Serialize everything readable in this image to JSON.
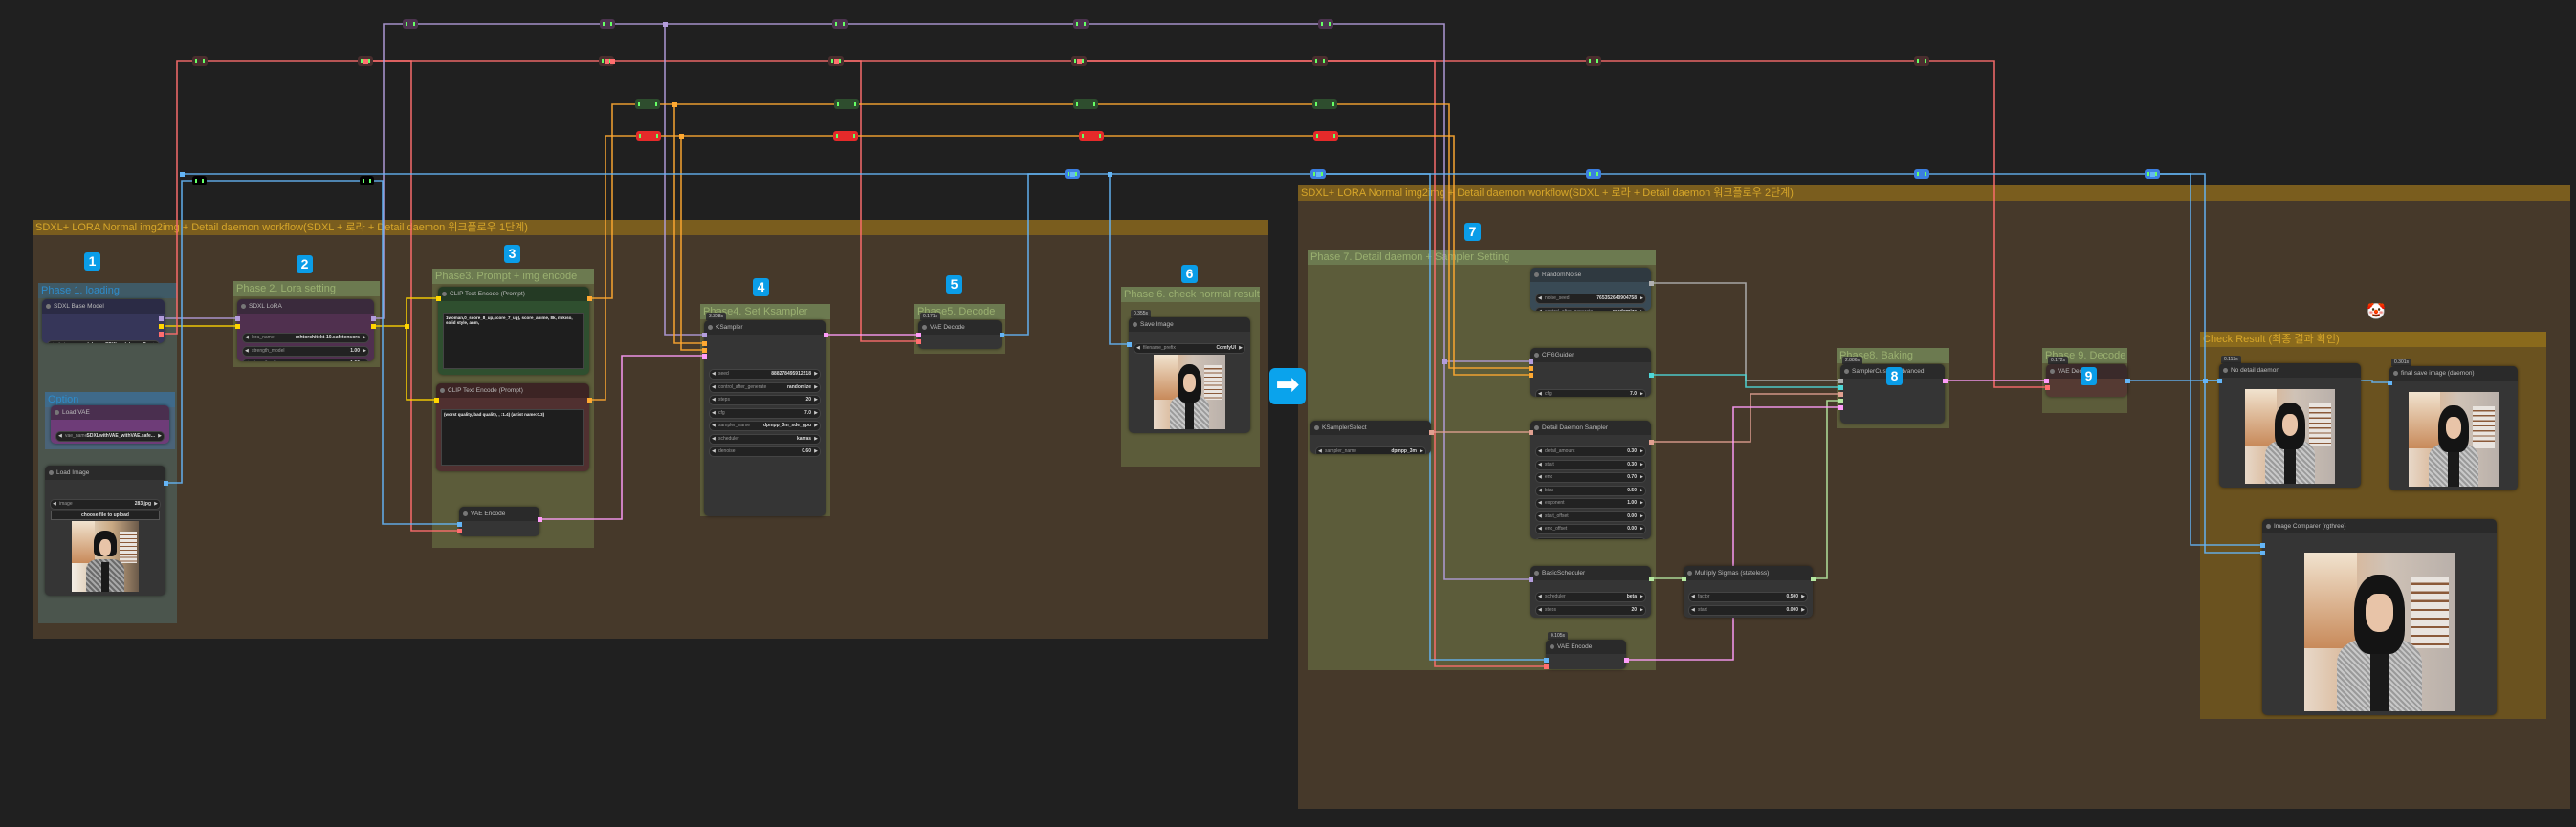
{
  "badges": [
    "1",
    "2",
    "3",
    "4",
    "5",
    "6",
    "7",
    "8",
    "9"
  ],
  "arrow_icon": "right-arrow-icon",
  "clown_emoji": "🤡",
  "groups": [
    {
      "id": "main1",
      "title": "SDXL+ LORA Normal img2img + Detail daemon workflow(SDXL + 로라 + Detail daemon 워크플로우 1단계)"
    },
    {
      "id": "main2",
      "title": "SDXL+ LORA Normal img2img + Detail daemon workflow(SDXL + 로라 + Detail daemon 워크플로우 2단계)"
    },
    {
      "id": "p1",
      "title": "Phase 1. loading"
    },
    {
      "id": "opt",
      "title": "Option"
    },
    {
      "id": "p2",
      "title": "Phase 2. Lora setting"
    },
    {
      "id": "p3",
      "title": "Phase3. Prompt  + img encode"
    },
    {
      "id": "p4",
      "title": "Phase4. Set Ksampler"
    },
    {
      "id": "p5",
      "title": "Phase5. Decode"
    },
    {
      "id": "p6",
      "title": "Phase 6. check normal result"
    },
    {
      "id": "p7",
      "title": "Phase 7. Detail daemon + Sampler Setting"
    },
    {
      "id": "p8",
      "title": "Phase8. Baking"
    },
    {
      "id": "p9",
      "title": "Phase 9. Decode"
    },
    {
      "id": "check",
      "title": "Check Result (최종 결과 확인)"
    }
  ],
  "nodes": [
    {
      "id": "base",
      "title": "SDXL Base Model",
      "widgets": [
        {
          "label": "ckpt_name",
          "value": "sdxlanmeSDXL_sdxlanmeC..."
        }
      ]
    },
    {
      "id": "vae",
      "title": "Load VAE",
      "widgets": [
        {
          "label": "vae_name",
          "value": "SDXLwithVAE_withVAE.safe..."
        }
      ]
    },
    {
      "id": "loadimg",
      "title": "Load Image",
      "widgets": [
        {
          "label": "image",
          "value": "283.jpg"
        }
      ],
      "button": "choose file to upload",
      "image": "real"
    },
    {
      "id": "lora",
      "title": "SDXL LoRA",
      "widgets": [
        {
          "label": "lora_name",
          "value": "mhtorchitekt-10.safetensors"
        },
        {
          "label": "strength_model",
          "value": "1.00"
        },
        {
          "label": "strength_clip",
          "value": "1.00"
        }
      ]
    },
    {
      "id": "clippos",
      "title": "CLIP Text Encode (Prompt)",
      "prompt": "1woman,0_score_8_up,score_7_up), score_anime, 8k, mikiso, solid style, anm,"
    },
    {
      "id": "clipneg",
      "title": "CLIP Text Encode (Prompt)",
      "prompt": "(worst quality, bad quality, , :1.4) (artist name:0.3)"
    },
    {
      "id": "vaeenc1",
      "title": "VAE Encode"
    },
    {
      "id": "ksampler",
      "title": "KSampler",
      "timing": "3.308s",
      "widgets": [
        {
          "label": "seed",
          "value": "888278495912218"
        },
        {
          "label": "control_after_generate",
          "value": "randomize"
        },
        {
          "label": "steps",
          "value": "20"
        },
        {
          "label": "cfg",
          "value": "7.0"
        },
        {
          "label": "sampler_name",
          "value": "dpmpp_3m_sde_gpu"
        },
        {
          "label": "scheduler",
          "value": "karras"
        },
        {
          "label": "denoise",
          "value": "0.60"
        }
      ]
    },
    {
      "id": "vaedec1",
      "title": "VAE Decode",
      "timing": "0.171s"
    },
    {
      "id": "save1",
      "title": "Save Image",
      "timing": "0.355s",
      "widgets": [
        {
          "label": "filename_prefix",
          "value": "ComfyUI"
        }
      ],
      "image": "anime"
    },
    {
      "id": "noise",
      "title": "RandomNoise",
      "widgets": [
        {
          "label": "noise_seed",
          "value": "765352640904758"
        },
        {
          "label": "control_after_generate",
          "value": "randomize"
        }
      ]
    },
    {
      "id": "cfg",
      "title": "CFGGuider",
      "widgets": [
        {
          "label": "cfg",
          "value": "7.0"
        }
      ]
    },
    {
      "id": "kss",
      "title": "KSamplerSelect",
      "widgets": [
        {
          "label": "sampler_name",
          "value": "dpmpp_3m"
        }
      ]
    },
    {
      "id": "dd",
      "title": "Detail Daemon Sampler",
      "widgets": [
        {
          "label": "detail_amount",
          "value": "0.30"
        },
        {
          "label": "start",
          "value": "0.30"
        },
        {
          "label": "end",
          "value": "0.70"
        },
        {
          "label": "bias",
          "value": "0.50"
        },
        {
          "label": "exponent",
          "value": "1.00"
        },
        {
          "label": "start_offset",
          "value": "0.00"
        },
        {
          "label": "end_offset",
          "value": "0.00"
        },
        {
          "label": "fade",
          "value": "0.00"
        },
        {
          "label": "smooth",
          "value": "true"
        },
        {
          "label": "cfg_scale_override",
          "value": "0.0"
        }
      ]
    },
    {
      "id": "sched",
      "title": "BasicScheduler",
      "widgets": [
        {
          "label": "scheduler",
          "value": "beta"
        },
        {
          "label": "steps",
          "value": "20"
        },
        {
          "label": "denoise",
          "value": "0.25"
        }
      ]
    },
    {
      "id": "mult",
      "title": "Multiply Sigmas (stateless)",
      "widgets": [
        {
          "label": "factor",
          "value": "0.500"
        },
        {
          "label": "start",
          "value": "0.000"
        },
        {
          "label": "end",
          "value": "1.000"
        }
      ]
    },
    {
      "id": "vaeenc2",
      "title": "VAE Encode",
      "timing": "0.105s"
    },
    {
      "id": "sca",
      "title": "SamplerCustomAdvanced",
      "timing": "2.886s"
    },
    {
      "id": "vaedec2",
      "title": "VAE Decode",
      "timing": "0.172s"
    },
    {
      "id": "nodd",
      "title": "No detail daemon",
      "timing": "0.113s",
      "image": "anime"
    },
    {
      "id": "finalsave",
      "title": "final save image (daemon)",
      "timing": "0.301s",
      "image": "anime"
    },
    {
      "id": "comparer",
      "title": "Image Comparer (rgthree)",
      "image": "anime"
    }
  ],
  "wire_colors": {
    "model": "#b39ddb",
    "clip": "#ffd500",
    "vae": "#ff6e6e",
    "conditioning": "#ffa931",
    "latent": "#ff9cf9",
    "image": "#64b5f6",
    "noise": "#b0b0b0",
    "guider": "#4ed8d8",
    "sampler": "#e0a090",
    "sigmas": "#b5e8a0"
  }
}
